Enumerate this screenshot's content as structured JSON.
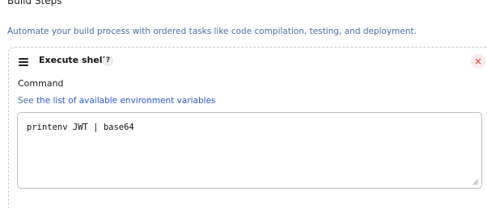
{
  "section": {
    "title": "Build Steps",
    "description": "Automate your build process with ordered tasks like code compilation, testing, and deployment."
  },
  "step": {
    "title": "Execute shell",
    "help_label": "?",
    "close_label": "×",
    "command_label": "Command",
    "env_prefix": "See ",
    "env_link": "the list of available environment variables",
    "command_value": "printenv JWT | base64"
  },
  "icons": {
    "drag": "drag-handle-icon",
    "help": "help-icon",
    "close": "close-icon",
    "resize": "resize-grip-icon"
  },
  "colors": {
    "link": "#2a5bd7",
    "description": "#4a6fa5",
    "close": "#d33333"
  }
}
